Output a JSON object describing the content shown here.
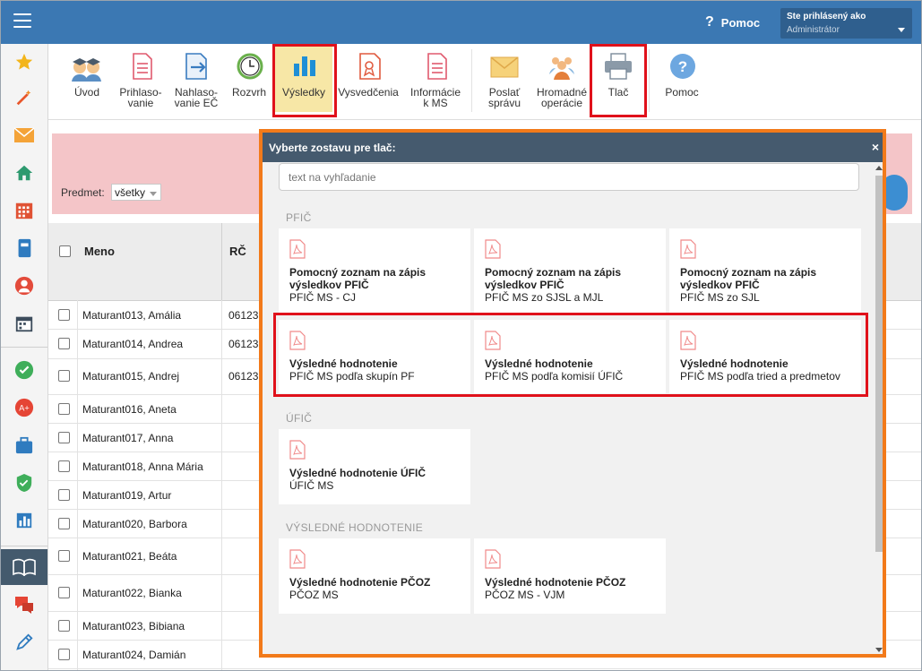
{
  "header": {
    "help_label": "Pomoc",
    "user_line1": "Ste prihlásený ako",
    "user_line2": "Administrátor"
  },
  "toolbar": {
    "items": [
      {
        "label": "Úvod",
        "icon": "graduates-icon"
      },
      {
        "label": "Prihlaso-\nvanie",
        "icon": "form-icon"
      },
      {
        "label": "Nahlaso-\nvanie EČ",
        "icon": "import-icon"
      },
      {
        "label": "Rozvrh",
        "icon": "clock-icon"
      },
      {
        "label": "Výsledky",
        "icon": "bar-chart-icon"
      },
      {
        "label": "Vysvedčenia",
        "icon": "certificate-icon"
      },
      {
        "label": "Informácie\nk MS",
        "icon": "document-icon"
      },
      {
        "label": "Poslať\nsprávu",
        "icon": "envelope-icon"
      },
      {
        "label": "Hromadné\noperácie",
        "icon": "group-icon"
      },
      {
        "label": "Tlač",
        "icon": "printer-icon"
      },
      {
        "label": "Pomoc",
        "icon": "help-icon"
      }
    ]
  },
  "filter": {
    "label": "Predmet:",
    "value": "všetky"
  },
  "grid": {
    "col_name": "Meno",
    "col_rc": "RČ",
    "rows": [
      {
        "name": "Maturant013, Amália",
        "rc": "06123"
      },
      {
        "name": "Maturant014, Andrea",
        "rc": "06123"
      },
      {
        "name": "Maturant015, Andrej",
        "rc": "06123"
      },
      {
        "name": "Maturant016, Aneta",
        "rc": ""
      },
      {
        "name": "Maturant017, Anna",
        "rc": ""
      },
      {
        "name": "Maturant018, Anna Mária",
        "rc": ""
      },
      {
        "name": "Maturant019, Artur",
        "rc": ""
      },
      {
        "name": "Maturant020, Barbora",
        "rc": ""
      },
      {
        "name": "Maturant021, Beáta",
        "rc": ""
      },
      {
        "name": "Maturant022, Bianka",
        "rc": ""
      },
      {
        "name": "Maturant023, Bibiana",
        "rc": ""
      },
      {
        "name": "Maturant024, Damián",
        "rc": ""
      }
    ]
  },
  "modal": {
    "title": "Vyberte zostavu pre tlač:",
    "close": "×",
    "search_placeholder": "text na vyhľadanie",
    "sections": [
      {
        "title": "PFIČ",
        "cards": [
          {
            "title": "Pomocný zoznam na zápis výsledkov PFIČ",
            "subtitle": "PFIČ MS - CJ"
          },
          {
            "title": "Pomocný zoznam na zápis výsledkov PFIČ",
            "subtitle": "PFIČ MS zo SJSL a MJL"
          },
          {
            "title": "Pomocný zoznam na zápis výsledkov PFIČ",
            "subtitle": "PFIČ MS zo SJL"
          },
          {
            "title": "Výsledné hodnotenie",
            "subtitle": "PFIČ MS podľa skupín PF"
          },
          {
            "title": "Výsledné hodnotenie",
            "subtitle": "PFIČ MS podľa komisií ÚFIČ"
          },
          {
            "title": "Výsledné hodnotenie",
            "subtitle": "PFIČ MS podľa tried a predmetov"
          }
        ]
      },
      {
        "title": "ÚFIČ",
        "cards": [
          {
            "title": "Výsledné hodnotenie ÚFIČ",
            "subtitle": "ÚFIČ MS"
          }
        ]
      },
      {
        "title": "VÝSLEDNÉ HODNOTENIE",
        "cards": [
          {
            "title": "Výsledné hodnotenie PČOZ",
            "subtitle": "PČOZ MS"
          },
          {
            "title": "Výsledné hodnotenie PČOZ",
            "subtitle": "PČOZ MS - VJM"
          }
        ]
      }
    ]
  },
  "colors": {
    "header": "#3b78b3",
    "modal_border": "#f27a1a",
    "highlight_box": "#e0111b",
    "filter_bg": "#f4c5c8",
    "active_tool": "#f7e7a6"
  }
}
